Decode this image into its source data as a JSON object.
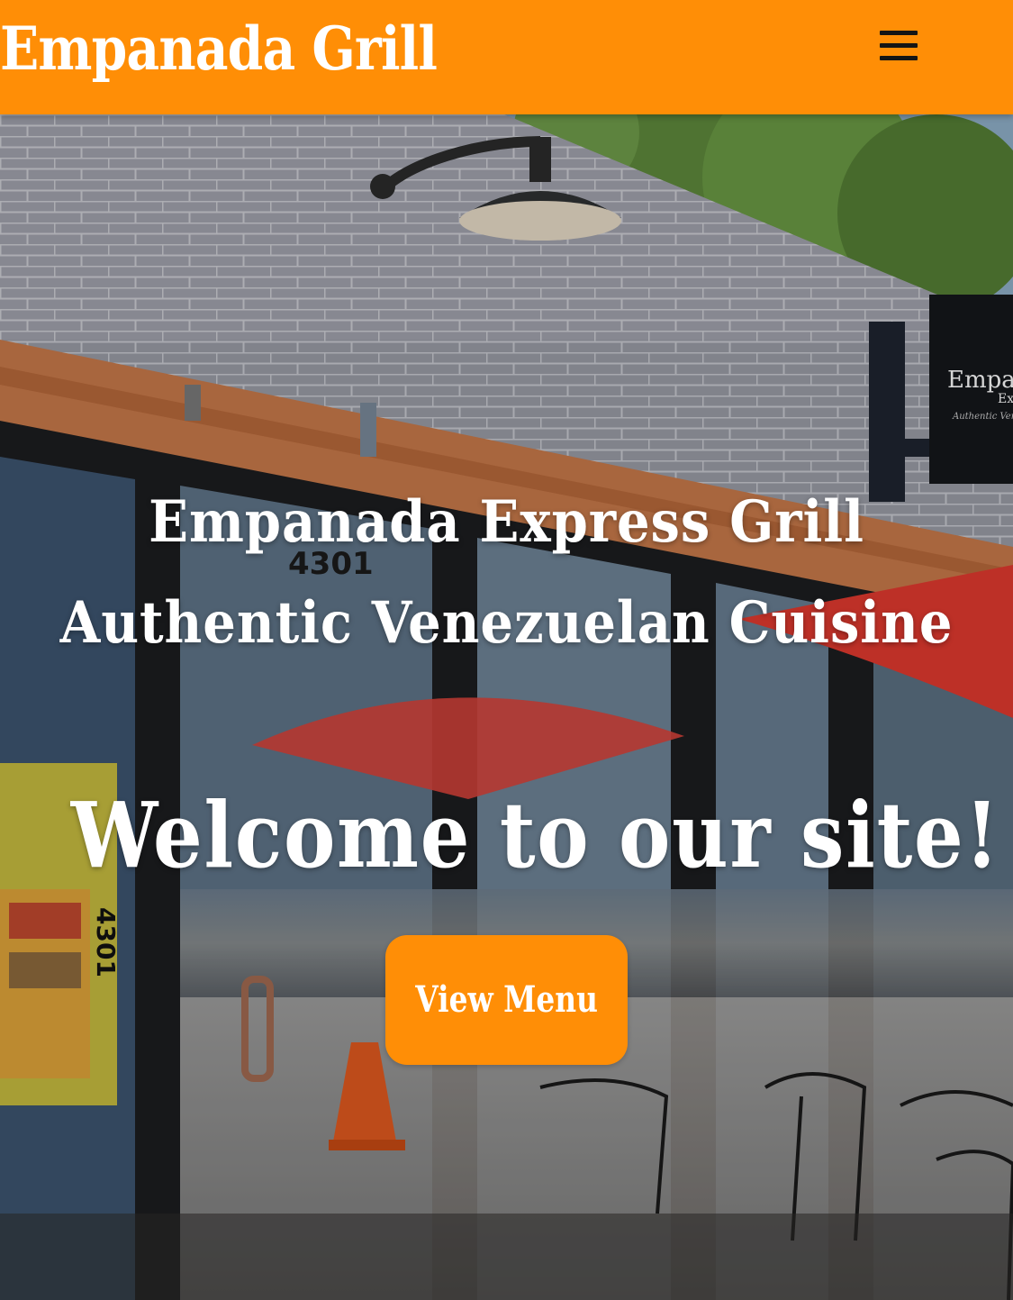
{
  "header": {
    "brand": "Empanada Grill",
    "menu_icon": "hamburger-menu-icon",
    "background_color": "#FF8E06"
  },
  "hero": {
    "photo": "storefront-photo",
    "title": "Empanada Express Grill",
    "subtitle": "Authentic Venezuelan Cuisine",
    "welcome": "Welcome to our site!",
    "address_number": "4301",
    "sign_text": "Empa",
    "cta_label": "View Menu",
    "cta_color": "#FF8E06"
  }
}
